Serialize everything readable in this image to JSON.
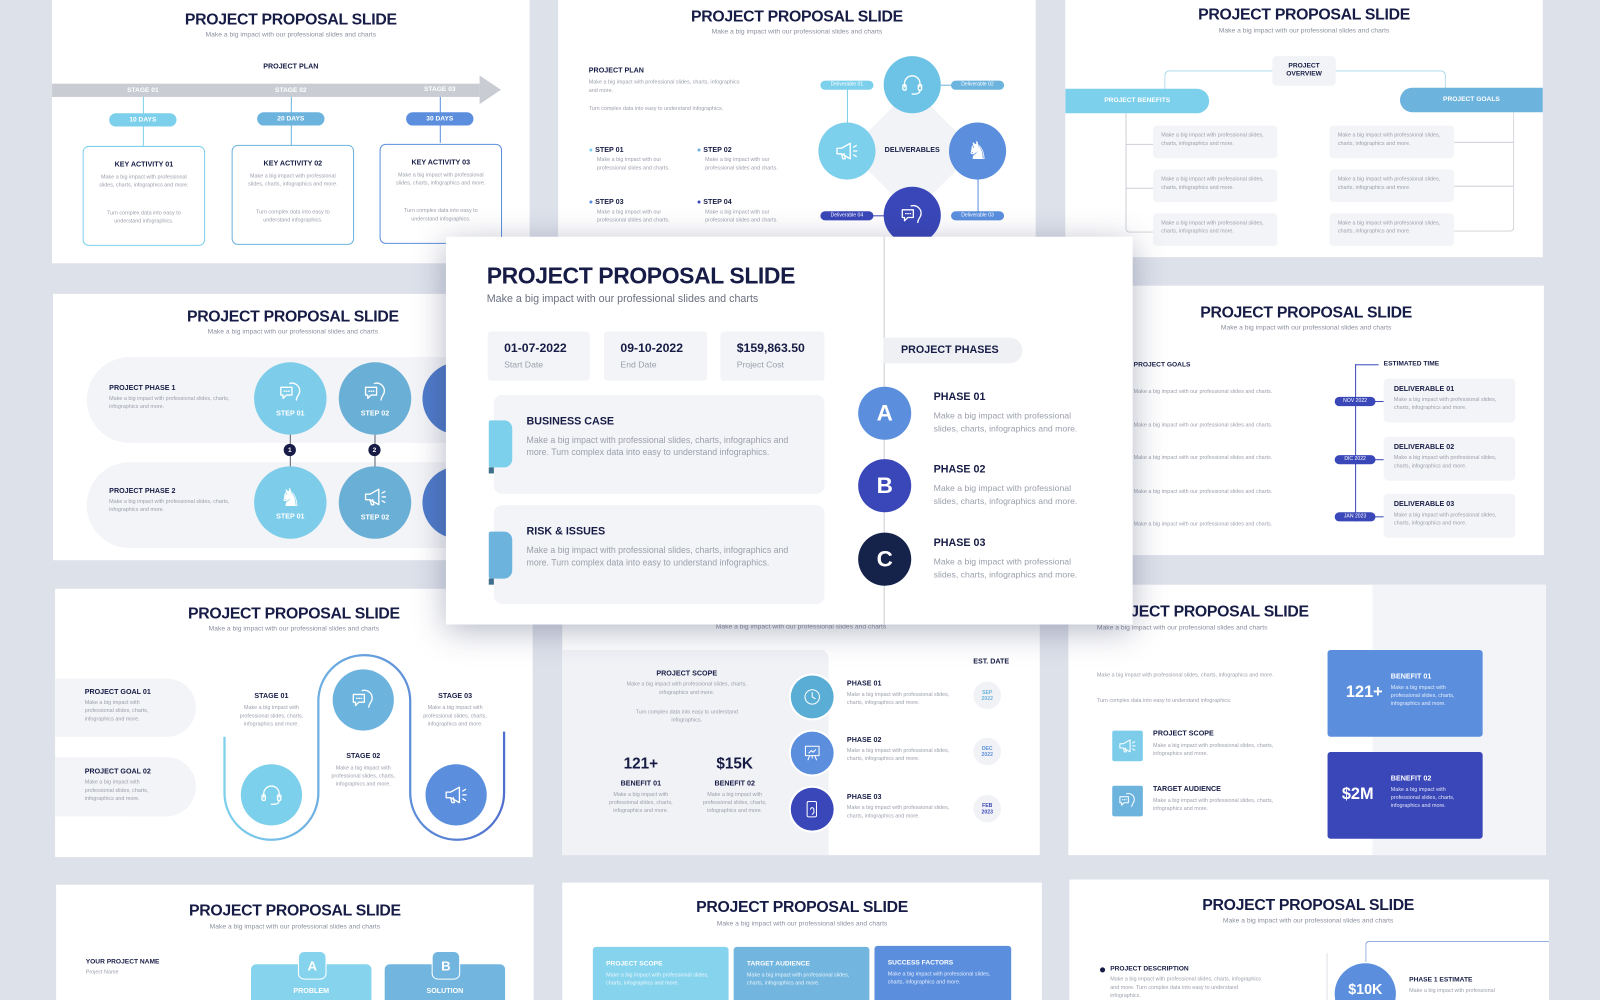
{
  "slide_title": "PROJECT PROPOSAL SLIDE",
  "slide_subtitle": "Make a big impact with our professional slides and charts",
  "colors": {
    "navy": "#161c45",
    "light_blue": "#7dd0ec",
    "sky_blue": "#6cb3de",
    "blue": "#5b8fde",
    "indigo": "#3a47b8",
    "dark_navy": "#15224a",
    "background": "#dde1ea"
  },
  "featured": {
    "info": [
      {
        "value": "01-07-2022",
        "label": "Start Date"
      },
      {
        "value": "09-10-2022",
        "label": "End Date"
      },
      {
        "value": "$159,863.50",
        "label": "Project Cost"
      }
    ],
    "cards": [
      {
        "title": "BUSINESS CASE",
        "text": "Make a big impact with professional slides, charts, infographics and more. Turn complex data into easy to understand infographics."
      },
      {
        "title": "RISK & ISSUES",
        "text": "Make a big impact with professional slides, charts, infographics and more. Turn complex data into easy to understand infographics."
      }
    ],
    "phases_label": "PROJECT PHASES",
    "phases": [
      {
        "letter": "A",
        "title": "PHASE 01",
        "text": "Make a big impact with professional slides, charts, infographics and more."
      },
      {
        "letter": "B",
        "title": "PHASE 02",
        "text": "Make a big impact with professional slides, charts, infographics and more."
      },
      {
        "letter": "C",
        "title": "PHASE 03",
        "text": "Make a big impact with professional slides, charts, infographics and more."
      }
    ]
  },
  "plan_slide": {
    "heading": "PROJECT PLAN",
    "stages": [
      {
        "stage": "STAGE 01",
        "days": "10 DAYS",
        "title": "KEY ACTIVITY 01",
        "text1": "Make a big impact with professional slides, charts, infographics and more.",
        "text2": "Turn complex data into easy to understand infographics."
      },
      {
        "stage": "STAGE 02",
        "days": "20 DAYS",
        "title": "KEY ACTIVITY 02",
        "text1": "Make a big impact with professional slides, charts, infographics and more.",
        "text2": "Turn complex data into easy to understand infographics."
      },
      {
        "stage": "STAGE 03",
        "days": "30 DAYS",
        "title": "KEY ACTIVITY 03",
        "text1": "Make a big impact with professional slides, charts, infographics and more.",
        "text2": "Turn complex data into easy to understand infographics."
      }
    ]
  },
  "deliverables_slide": {
    "heading": "PROJECT PLAN",
    "text1": "Make a big impact with professional slides, charts, infographics and more.",
    "text2": "Turn complex data into easy to understand infographics.",
    "steps": [
      {
        "title": "STEP 01",
        "text": "Make a big impact with our professional slides and charts."
      },
      {
        "title": "STEP 02",
        "text": "Make a big impact with our professional slides and charts."
      },
      {
        "title": "STEP 03",
        "text": "Make a big impact with our professional slides and charts."
      },
      {
        "title": "STEP 04",
        "text": "Make a big impact with our professional slides and charts."
      }
    ],
    "center": "DELIVERABLES",
    "deliverables": [
      "Deliverable 01",
      "Deliverable 02",
      "Deliverable 03",
      "Deliverable 04"
    ]
  },
  "overview_slide": {
    "center": "PROJECT OVERVIEW",
    "left": "PROJECT BENEFITS",
    "right": "PROJECT GOALS",
    "item": "Make a big impact with professional slides, charts, infographics and more."
  },
  "phases_slide": {
    "phases": [
      {
        "title": "PROJECT PHASE 1",
        "text": "Make a big impact with professional slides, charts, infographics and more.",
        "steps": [
          "STEP 01",
          "STEP 02"
        ]
      },
      {
        "title": "PROJECT PHASE 2",
        "text": "Make a big impact with professional slides, charts, infographics and more.",
        "steps": [
          "STEP 01",
          "STEP 02"
        ]
      }
    ],
    "markers": [
      "1",
      "2"
    ]
  },
  "goals_time_slide": {
    "goals_heading": "PROJECT GOALS",
    "goal_text": "Make a big impact with our professional slides and charts.",
    "time_heading": "ESTIMATED TIME",
    "items": [
      {
        "date": "NOV 2022",
        "title": "DELIVERABLE 01",
        "text": "Make a big impact with professional slides, charts, infographics and more."
      },
      {
        "date": "DIC 2022",
        "title": "DELIVERABLE 02",
        "text": "Make a big impact with professional slides, charts, infographics and more."
      },
      {
        "date": "JAN 2023",
        "title": "DELIVERABLE 03",
        "text": "Make a big impact with professional slides, charts, infographics and more."
      }
    ]
  },
  "stages_slide": {
    "goals": [
      {
        "title": "PROJECT GOAL 01",
        "text": "Make a big impact with professional slides, charts, infographics and more."
      },
      {
        "title": "PROJECT GOAL 02",
        "text": "Make a big impact with professional slides, charts, infographics and more."
      }
    ],
    "stages": [
      {
        "title": "STAGE 01",
        "text": "Make a big impact with professional slides, charts, infographics and more."
      },
      {
        "title": "STAGE 02",
        "text": "Make a big impact with professional slides, charts, infographics and more."
      },
      {
        "title": "STAGE 03",
        "text": "Make a big impact with professional slides, charts, infographics and more."
      }
    ]
  },
  "scope_slide": {
    "scope_title": "PROJECT SCOPE",
    "scope_text1": "Make a big impact with professional slides, charts, infographics and more.",
    "scope_text2": "Turn complex data into easy to understand infographics.",
    "benefits": [
      {
        "value": "121+",
        "title": "BENEFIT 01",
        "text": "Make a big impact with professional slides, charts, infographics and more."
      },
      {
        "value": "$15K",
        "title": "BENEFIT 02",
        "text": "Make a big impact with professional slides, charts, infographics and more."
      }
    ],
    "date_heading": "EST. DATE",
    "phases": [
      {
        "title": "PHASE 01",
        "text": "Make a big impact with professional slides, charts, infographics and more.",
        "month": "SEP",
        "year": "2022"
      },
      {
        "title": "PHASE 02",
        "text": "Make a big impact with professional slides, charts, infographics and more.",
        "month": "DEC",
        "year": "2022"
      },
      {
        "title": "PHASE 03",
        "text": "Make a big impact with professional slides, charts, infographics and more.",
        "month": "FEB",
        "year": "2023"
      }
    ]
  },
  "benefits_slide": {
    "text1": "Make a big impact with professional slides, charts, infographics and more.",
    "text2": "Turn complex data into easy to understand infographics.",
    "items": [
      {
        "title": "PROJECT SCOPE",
        "text": "Make a big impact with professional slides, charts, infographics and more."
      },
      {
        "title": "TARGET AUDIENCE",
        "text": "Make a big impact with professional slides, charts, infographics and more."
      }
    ],
    "benefits": [
      {
        "value": "121+",
        "title": "BENEFIT 01",
        "text": "Make a big impact with professional slides, charts, infographics and more."
      },
      {
        "value": "$2M",
        "title": "BENEFIT 02",
        "text": "Make a big impact with professional slides, charts, infographics and more."
      }
    ]
  },
  "problem_slide": {
    "name_label": "YOUR PROJECT NAME",
    "name_value": "Project Name",
    "cards": [
      {
        "letter": "A",
        "label": "PROBLEM"
      },
      {
        "letter": "B",
        "label": "SOLUTION"
      }
    ]
  },
  "factors_slide": {
    "columns": [
      {
        "title": "PROJECT SCOPE",
        "text": "Make a big impact with professional slides, charts, infographics and more."
      },
      {
        "title": "TARGET AUDIENCE",
        "text": "Make a big impact with professional slides, charts, infographics and more."
      },
      {
        "title": "SUCCESS FACTORS",
        "text": "Make a big impact with professional slides, charts, infographics and more."
      }
    ]
  },
  "estimate_slide": {
    "desc_title": "PROJECT DESCRIPTION",
    "desc_text": "Make a big impact with professional slides, charts, infographics and more. Turn complex data into easy to understand infographics.",
    "value": "$10K",
    "estimate_title": "PHASE 1 ESTIMATE",
    "estimate_text": "Make a big impact with professional"
  }
}
